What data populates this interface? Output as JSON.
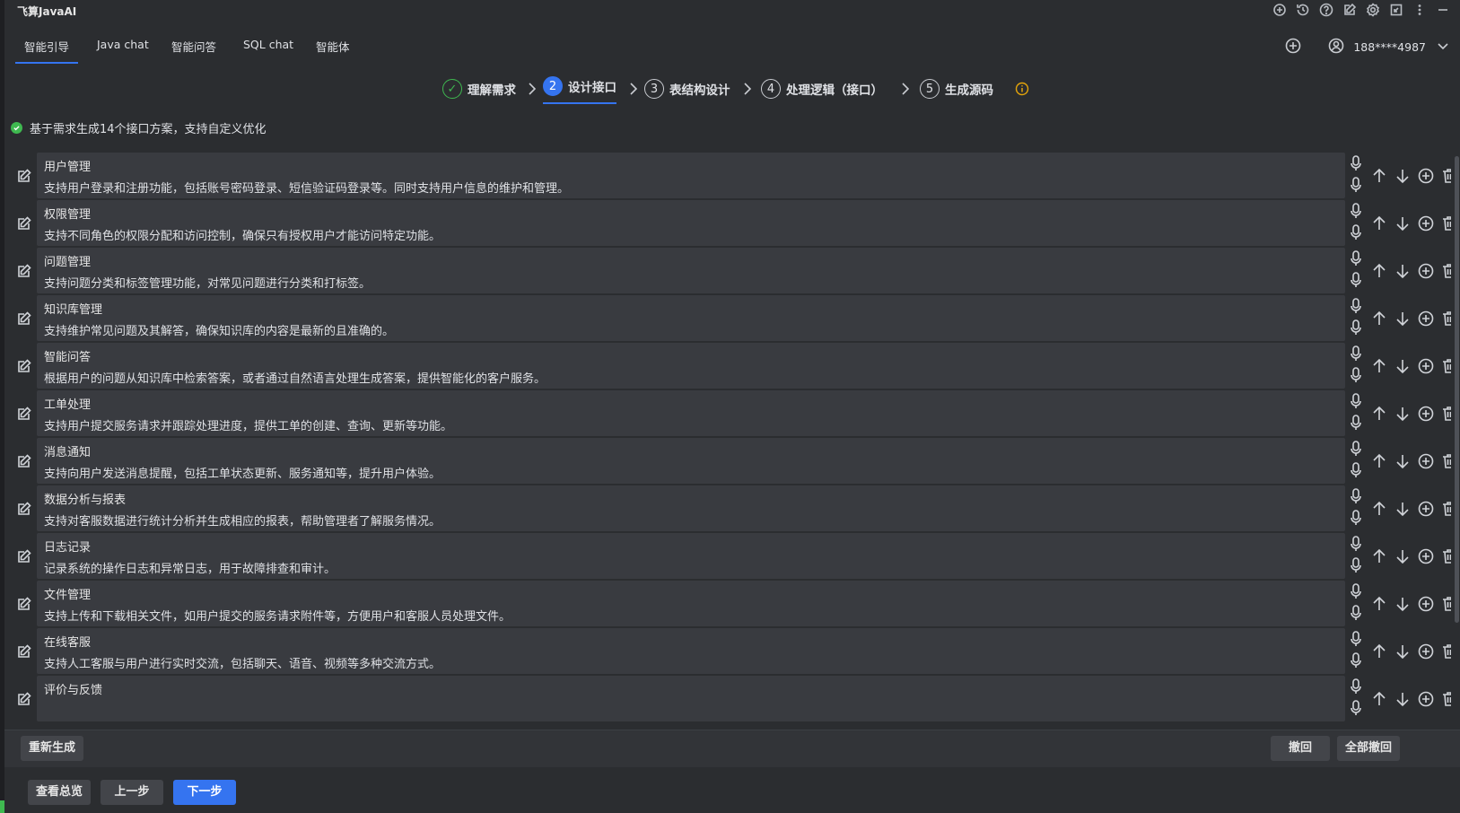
{
  "app": {
    "title": "飞算JavaAI"
  },
  "tabs": [
    {
      "label": "智能引导"
    },
    {
      "label": "Java chat"
    },
    {
      "label": "智能问答"
    },
    {
      "label": "SQL chat"
    },
    {
      "label": "智能体"
    }
  ],
  "user": {
    "phone": "188****4987"
  },
  "steps": [
    {
      "num": "✓",
      "label": "理解需求",
      "state": "done"
    },
    {
      "num": "2",
      "label": "设计接口",
      "state": "active"
    },
    {
      "num": "3",
      "label": "表结构设计",
      "state": "pending"
    },
    {
      "num": "4",
      "label": "处理逻辑（接口）",
      "state": "pending"
    },
    {
      "num": "5",
      "label": "生成源码",
      "state": "pending"
    }
  ],
  "notice": {
    "text": "基于需求生成14个接口方案，支持自定义优化"
  },
  "items": [
    {
      "name": "用户管理",
      "desc": "支持用户登录和注册功能，包括账号密码登录、短信验证码登录等。同时支持用户信息的维护和管理。"
    },
    {
      "name": "权限管理",
      "desc": "支持不同角色的权限分配和访问控制，确保只有授权用户才能访问特定功能。"
    },
    {
      "name": "问题管理",
      "desc": "支持问题分类和标签管理功能，对常见问题进行分类和打标签。"
    },
    {
      "name": "知识库管理",
      "desc": "支持维护常见问题及其解答，确保知识库的内容是最新的且准确的。"
    },
    {
      "name": "智能问答",
      "desc": "根据用户的问题从知识库中检索答案，或者通过自然语言处理生成答案，提供智能化的客户服务。"
    },
    {
      "name": "工单处理",
      "desc": "支持用户提交服务请求并跟踪处理进度，提供工单的创建、查询、更新等功能。"
    },
    {
      "name": "消息通知",
      "desc": "支持向用户发送消息提醒，包括工单状态更新、服务通知等，提升用户体验。"
    },
    {
      "name": "数据分析与报表",
      "desc": "支持对客服数据进行统计分析并生成相应的报表，帮助管理者了解服务情况。"
    },
    {
      "name": "日志记录",
      "desc": "记录系统的操作日志和异常日志，用于故障排查和审计。"
    },
    {
      "name": "文件管理",
      "desc": "支持上传和下载相关文件，如用户提交的服务请求附件等，方便用户和客服人员处理文件。"
    },
    {
      "name": "在线客服",
      "desc": "支持人工客服与用户进行实时交流，包括聊天、语音、视频等多种交流方式。"
    },
    {
      "name": "评价与反馈",
      "desc": ""
    }
  ],
  "actions": {
    "regenerate": "重新生成",
    "undo": "撤回",
    "undo_all": "全部撤回",
    "overview": "查看总览",
    "prev": "上一步",
    "next": "下一步"
  },
  "colors": {
    "accent": "#3574f0",
    "success": "#3fb950",
    "warning": "#e5a50a"
  }
}
